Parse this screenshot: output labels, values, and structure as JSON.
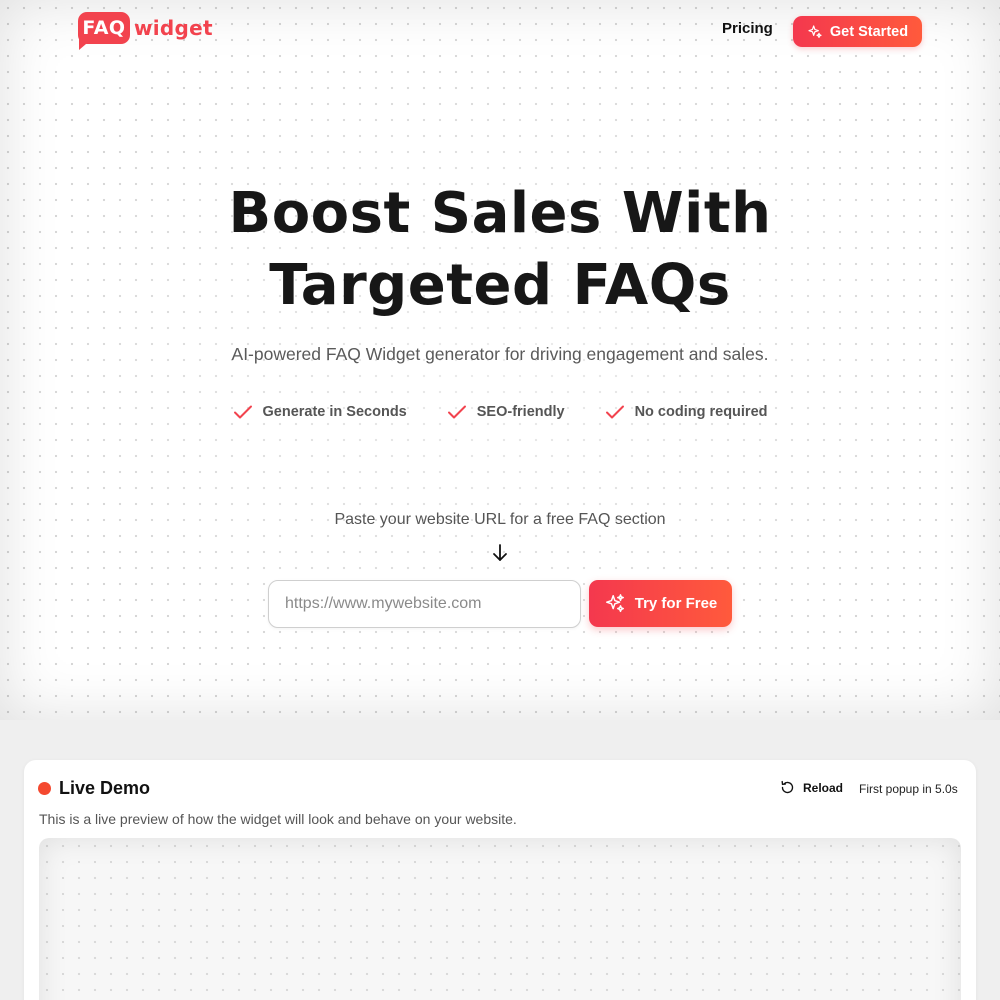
{
  "logo": {
    "badge": "FAQ",
    "word": "widget"
  },
  "nav": {
    "pricing": "Pricing",
    "get_started": "Get Started"
  },
  "hero": {
    "title_line1": "Boost Sales With",
    "title_line2": "Targeted FAQs",
    "subtitle": "AI-powered FAQ Widget generator for driving engagement and sales.",
    "features": [
      "Generate in Seconds",
      "SEO-friendly",
      "No coding required"
    ],
    "prompt": "Paste your website URL for a free FAQ section",
    "url_placeholder": "https://www.mywebsite.com",
    "url_value": "",
    "try_button": "Try for Free"
  },
  "demo": {
    "title": "Live Demo",
    "reload": "Reload",
    "popup_timer": "First popup in 5.0s",
    "description": "This is a live preview of how the widget will look and behave on your website."
  },
  "colors": {
    "brand": "#f2434e",
    "brand_gradient_end": "#ff5a3c",
    "live_dot": "#f4492f",
    "check": "#f2434e"
  },
  "icons": {
    "nav_button": "sparkle-icon",
    "features": "check-icon",
    "prompt": "arrow-down-icon",
    "try_button": "sparkle-icon",
    "reload": "reload-icon"
  }
}
